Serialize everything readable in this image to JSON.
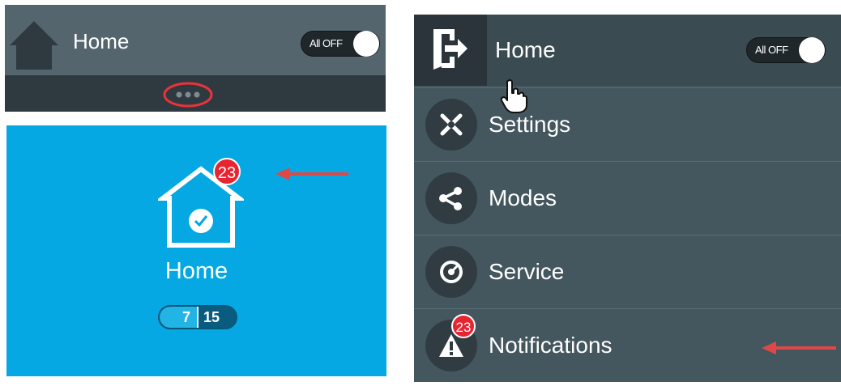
{
  "panel_top": {
    "title": "Home",
    "toggle_label": "All OFF"
  },
  "panel_tile": {
    "title": "Home",
    "badge_count": "23",
    "counter_left": "7",
    "counter_right": "15"
  },
  "panel_menu": {
    "title": "Home",
    "toggle_label": "All OFF",
    "items": [
      {
        "label": "Settings",
        "icon": "wrench-screwdriver-icon"
      },
      {
        "label": "Modes",
        "icon": "share-nodes-icon"
      },
      {
        "label": "Service",
        "icon": "gauge-icon"
      },
      {
        "label": "Notifications",
        "icon": "warning-triangle-icon",
        "badge": "23"
      }
    ]
  },
  "colors": {
    "tile_blue": "#05a8e2",
    "badge_red": "#e82430",
    "arrow_red": "#e04848",
    "menu_bg": "#44565e"
  }
}
